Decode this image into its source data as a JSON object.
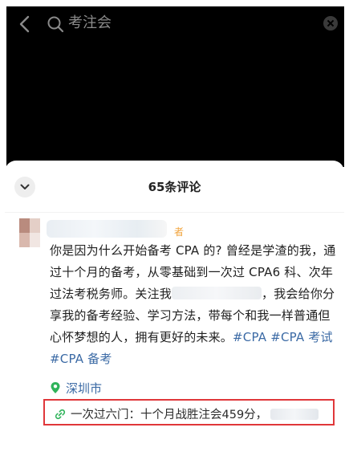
{
  "search": {
    "query": "考注会"
  },
  "comments": {
    "count_title": "65条评论"
  },
  "comment": {
    "author_tag": "者",
    "text_before_mask": "你是因为什么开始备考 CPA 的? 曾经是学渣的我，通过十个月的备考，从零基础到一次过 CPA6 科、次年过法考税务师。关注我",
    "text_after_mask": "，我会给你分享我的备考经验、学习方法，带每个和我一样普通但心怀梦想的人，拥有更好的未来。",
    "hashtags": [
      "#CPA",
      "#CPA 考试",
      "#CPA 备考"
    ],
    "location": "深圳市",
    "link_label": "一次过六门：十个月战胜注会459分，"
  },
  "colors": {
    "accent_link": "#3b6aa5",
    "highlight_border": "#e0373a",
    "author_tag": "#f1a33b",
    "location_pin": "#2fb35a"
  },
  "icons": [
    "back-arrow-icon",
    "search-icon",
    "clear-icon",
    "chevron-down-icon",
    "location-pin-icon",
    "link-icon"
  ]
}
